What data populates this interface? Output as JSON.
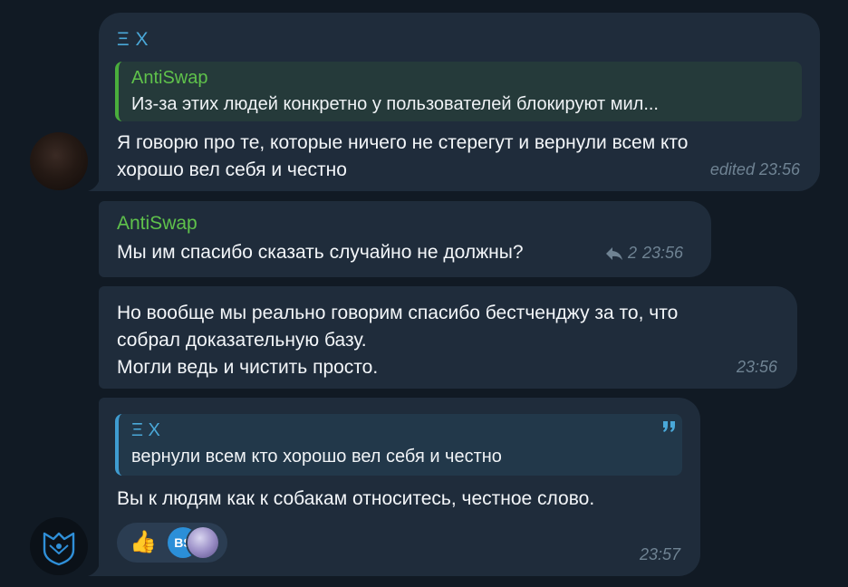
{
  "colors": {
    "background": "#111a24",
    "bubble": "#1f2c3b",
    "sender_green": "#5fc24b",
    "sender_blue": "#4aa8d8",
    "time_gray": "#6f8393"
  },
  "messages": [
    {
      "sender": "Ξ X",
      "reply": {
        "name": "AntiSwap",
        "text": "Из-за этих людей конкретно у пользователей блокируют мил..."
      },
      "text": "Я говорю про те, которые ничего не стерегут  и вернули всем кто\nхорошо вел себя и честно",
      "time": "edited 23:56"
    },
    {
      "sender": "AntiSwap",
      "text": "Мы им спасибо сказать случайно не должны?",
      "reply_count": "2",
      "time": "23:56"
    },
    {
      "text": "Но вообще мы реально говорим спасибо бестченджу за то, что\nсобрал доказательную базу.\nМогли ведь и чистить просто.",
      "time": "23:56"
    },
    {
      "quote": {
        "name": "Ξ X",
        "text": "вернули всем кто хорошо вел себя и честно",
        "icon": "quote-icon"
      },
      "text": "Вы к людям как к собакам относитесь, честное слово.",
      "reactions": {
        "emoji": "👍",
        "avatar_initials": "BS"
      },
      "time": "23:57"
    }
  ]
}
